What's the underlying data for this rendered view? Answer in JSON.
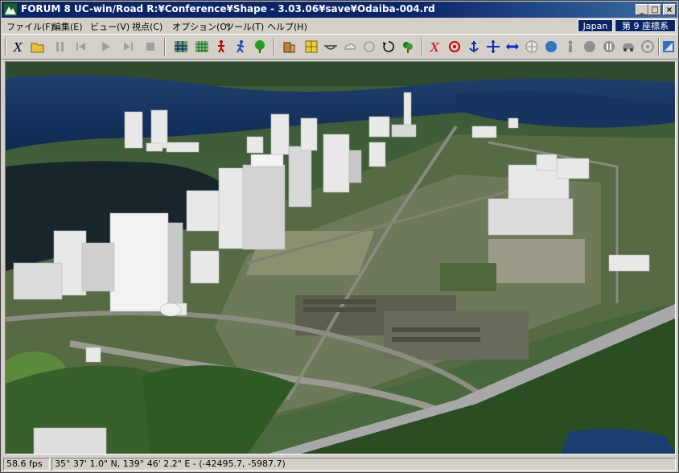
{
  "window": {
    "title": "FORUM 8   UC-win/Road    R:¥Conference¥Shape - 3.03.06¥save¥Odaiba-004.rd",
    "controls": {
      "minimize": "_",
      "maximize": "□",
      "close": "×"
    }
  },
  "menu": {
    "items": [
      "ファイル(F)",
      "編集(E)",
      "ビュー(V)",
      "視点(C)",
      "オプション(O)",
      "ツール(T)",
      "ヘルプ(H)"
    ]
  },
  "badges": {
    "region": "Japan",
    "coord_system": "第 9 座標系"
  },
  "toolbar": {
    "icons": [
      "road-tool-icon",
      "open-folder-icon",
      "pause-icon",
      "step-back-icon",
      "play-icon",
      "step-forward-icon",
      "stop-icon",
      "terrain-map-icon",
      "grid-map-icon",
      "person-walk-icon",
      "person-run-icon",
      "tree-icon",
      "building-icon",
      "texture-icon",
      "bridge-icon",
      "cloud-icon",
      "fog-icon",
      "rotate-icon",
      "plant-icon",
      "road-active-icon",
      "target-icon",
      "anchor-icon",
      "move-cross-icon",
      "arrow-left-right-icon",
      "compass-icon",
      "globe-icon",
      "figure-icon",
      "record-icon",
      "pause-round-icon",
      "car-icon",
      "wheel-icon",
      "expand-icon"
    ]
  },
  "status": {
    "fps": "58.6 fps",
    "coords": "35°   37' 1.0\" N, 139°   46' 2.2\"  E  -  (-42495.7, -5987.7)"
  },
  "colors": {
    "titlebar": "#0a246a",
    "chrome": "#d4d0c8",
    "badge": "#0a246a"
  }
}
